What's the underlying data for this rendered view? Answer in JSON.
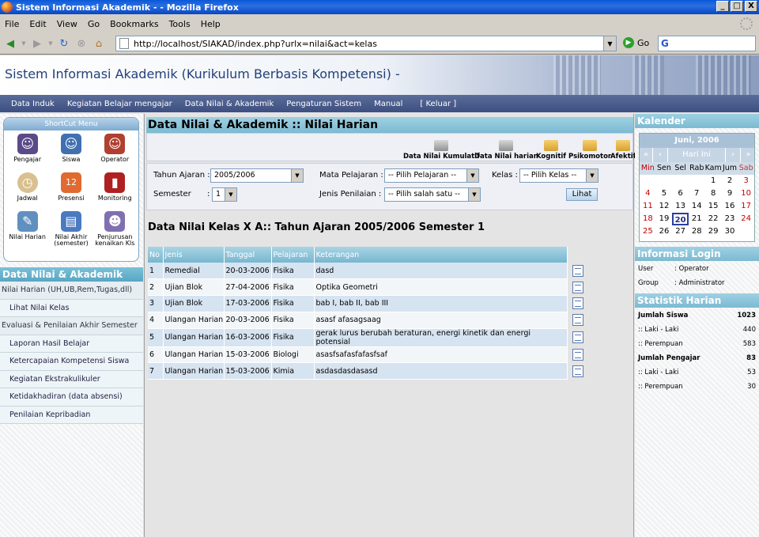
{
  "window": {
    "title": "Sistem Informasi Akademik - - Mozilla Firefox",
    "controls": [
      "_",
      "□",
      "X"
    ]
  },
  "menubar": [
    "File",
    "Edit",
    "View",
    "Go",
    "Bookmarks",
    "Tools",
    "Help"
  ],
  "navbar": {
    "url": "http://localhost/SIAKAD/index.php?urlx=nilai&act=kelas",
    "go": "Go",
    "search_logo": "G"
  },
  "banner": {
    "title": "Sistem Informasi Akademik (Kurikulum Berbasis Kompetensi) -"
  },
  "topnav": [
    "Data Induk",
    "Kegiatan Belajar mengajar",
    "Data Nilai & Akademik",
    "Pengaturan Sistem",
    "Manual",
    "[ Keluar ]"
  ],
  "shortcut": {
    "title": "ShortCut Menu",
    "items": [
      {
        "label": "Pengajar",
        "icon": "teacher-icon",
        "color": "#5a4a8a"
      },
      {
        "label": "Siswa",
        "icon": "student-icon",
        "color": "#4070b0"
      },
      {
        "label": "Operator",
        "icon": "operator-icon",
        "color": "#b04030"
      },
      {
        "label": "Jadwal",
        "icon": "clock-icon",
        "color": "#d8c090"
      },
      {
        "label": "Presensi",
        "icon": "calendar-icon",
        "color": "#e06a30"
      },
      {
        "label": "Monitoring",
        "icon": "book-icon",
        "color": "#b02020"
      },
      {
        "label": "Nilai Harian",
        "icon": "edit-icon",
        "color": "#6090c0"
      },
      {
        "label": "Nilai Akhir (semester)",
        "icon": "chart-icon",
        "color": "#4a7ac0"
      },
      {
        "label": "Penjurusan kenaikan Kls",
        "icon": "group-icon",
        "color": "#8070b0"
      }
    ]
  },
  "sidebar": {
    "title": "Data Nilai & Akademik",
    "items": [
      {
        "label": "Nilai Harian (UH,UB,Rem,Tugas,dll)",
        "group": true
      },
      {
        "label": "Lihat Nilai Kelas",
        "group": false
      },
      {
        "label": "Evaluasi & Penilaian Akhir Semester",
        "group": true
      },
      {
        "label": "Laporan Hasil Belajar",
        "group": false
      },
      {
        "label": "Ketercapaian Kompetensi Siswa",
        "group": false
      },
      {
        "label": "Kegiatan Ekstrakulikuler",
        "group": false
      },
      {
        "label": "Ketidakhadiran (data absensi)",
        "group": false
      },
      {
        "label": "Penilaian Kepribadian",
        "group": false
      }
    ]
  },
  "main": {
    "title": "Data Nilai & Akademik :: Nilai Harian",
    "toolbar": [
      "Data Nilai Kumulatif",
      "Data Nilai harian",
      "Kognitif",
      "Psikomotor",
      "Afektif"
    ],
    "filter": {
      "tahun_label": "Tahun Ajaran :",
      "tahun_value": "2005/2006",
      "semester_label": "Semester",
      "semester_colon": ":",
      "semester_value": "1",
      "mapel_label": "Mata Pelajaran :",
      "mapel_value": "-- Pilih Pelajaran --",
      "kelas_label": "Kelas :",
      "kelas_value": "-- Pilih Kelas --",
      "jenis_label": "Jenis Penilaian :",
      "jenis_value": "-- Pilih salah satu --",
      "button": "Lihat"
    },
    "data_heading": "Data Nilai Kelas X A:: Tahun Ajaran 2005/2006 Semester 1",
    "table": {
      "headers": [
        "No",
        "Jenis",
        "Tanggal",
        "Pelajaran",
        "Keterangan"
      ],
      "rows": [
        [
          "1",
          "Remedial",
          "20-03-2006",
          "Fisika",
          "dasd"
        ],
        [
          "2",
          "Ujian Blok",
          "27-04-2006",
          "Fisika",
          "Optika Geometri"
        ],
        [
          "3",
          "Ujian Blok",
          "17-03-2006",
          "Fisika",
          "bab I, bab II, bab III"
        ],
        [
          "4",
          "Ulangan Harian",
          "20-03-2006",
          "Fisika",
          "asasf afasagsaag"
        ],
        [
          "5",
          "Ulangan Harian",
          "16-03-2006",
          "Fisika",
          "gerak lurus berubah beraturan, energi kinetik dan energi potensial"
        ],
        [
          "6",
          "Ulangan Harian",
          "15-03-2006",
          "Biologi",
          "asasfsafasfafasfsaf"
        ],
        [
          "7",
          "Ulangan Harian",
          "15-03-2006",
          "Kimia",
          "asdasdasdasasd"
        ]
      ]
    }
  },
  "calendar": {
    "title": "Kalender",
    "month": "Juni, 2006",
    "nav": [
      "«",
      "‹",
      "Hari Ini",
      "›",
      "»"
    ],
    "days": [
      "Min",
      "Sen",
      "Sel",
      "Rab",
      "Kam",
      "Jum",
      "Sab"
    ],
    "weeks": [
      [
        "",
        "",
        "",
        "",
        "1",
        "2",
        "3"
      ],
      [
        "4",
        "5",
        "6",
        "7",
        "8",
        "9",
        "10"
      ],
      [
        "11",
        "12",
        "13",
        "14",
        "15",
        "16",
        "17"
      ],
      [
        "18",
        "19",
        "20",
        "21",
        "22",
        "23",
        "24"
      ],
      [
        "25",
        "26",
        "27",
        "28",
        "29",
        "30",
        ""
      ]
    ],
    "today": "20"
  },
  "login": {
    "title": "Informasi Login",
    "user_label": "User",
    "user_value": ": Operator",
    "group_label": "Group",
    "group_value": ": Administrator"
  },
  "stats": {
    "title": "Statistik Harian",
    "siswa_label": "Jumlah Siswa",
    "siswa": "1023",
    "siswa_l_label": ":: Laki - Laki",
    "siswa_l": "440",
    "siswa_p_label": ":: Perempuan",
    "siswa_p": "583",
    "pengajar_label": "Jumlah Pengajar",
    "pengajar": "83",
    "pengajar_l_label": ":: Laki - Laki",
    "pengajar_l": "53",
    "pengajar_p_label": ":: Perempuan",
    "pengajar_p": "30"
  }
}
